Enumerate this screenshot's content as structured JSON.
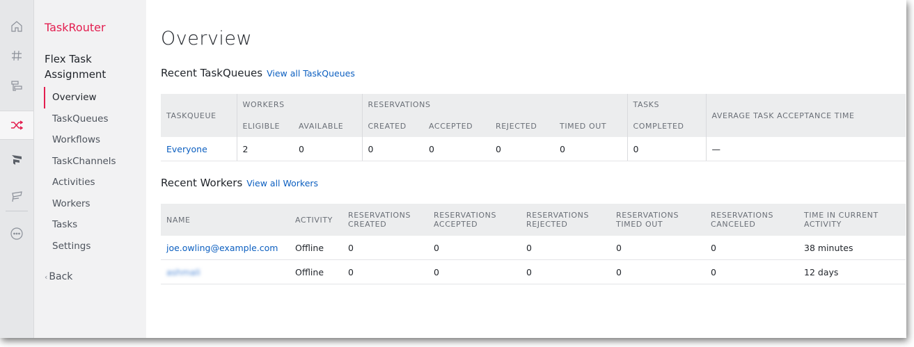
{
  "rail": {
    "icons": [
      "home-icon",
      "hash-icon",
      "studio-icon",
      "taskrouter-icon",
      "flex-icon",
      "functions-icon",
      "more-icon"
    ]
  },
  "nav": {
    "product": "TaskRouter",
    "workspace": "Flex Task Assignment",
    "items": [
      {
        "label": "Overview",
        "active": true
      },
      {
        "label": "TaskQueues"
      },
      {
        "label": "Workflows"
      },
      {
        "label": "TaskChannels"
      },
      {
        "label": "Activities"
      },
      {
        "label": "Workers"
      },
      {
        "label": "Tasks"
      },
      {
        "label": "Settings"
      }
    ],
    "back": "Back"
  },
  "main": {
    "title": "Overview",
    "queues": {
      "title": "Recent TaskQueues",
      "link": "View all TaskQueues",
      "group_headers": {
        "workers": "WORKERS",
        "reservations": "RESERVATIONS",
        "tasks": "TASKS"
      },
      "headers": {
        "taskqueue": "TASKQUEUE",
        "eligible": "ELIGIBLE",
        "available": "AVAILABLE",
        "created": "CREATED",
        "accepted": "ACCEPTED",
        "rejected": "REJECTED",
        "timed_out": "TIMED OUT",
        "completed": "COMPLETED",
        "avg_time": "AVERAGE TASK ACCEPTANCE TIME"
      },
      "rows": [
        {
          "name": "Everyone",
          "eligible": "2",
          "available": "0",
          "created": "0",
          "accepted": "0",
          "rejected": "0",
          "timed_out": "0",
          "completed": "0",
          "avg_time": "—"
        }
      ]
    },
    "workers": {
      "title": "Recent Workers",
      "link": "View all Workers",
      "headers": {
        "name": "NAME",
        "activity": "ACTIVITY",
        "res_created": "RESERVATIONS CREATED",
        "res_accepted": "RESERVATIONS ACCEPTED",
        "res_rejected": "RESERVATIONS REJECTED",
        "res_timed_out": "RESERVATIONS TIMED OUT",
        "res_canceled": "RESERVATIONS CANCELED",
        "time_in_activity": "TIME IN CURRENT ACTIVITY"
      },
      "rows": [
        {
          "name": "joe.owling@example.com",
          "activity": "Offline",
          "created": "0",
          "accepted": "0",
          "rejected": "0",
          "timed_out": "0",
          "canceled": "0",
          "time": "38 minutes"
        },
        {
          "name": "ashmali",
          "activity": "Offline",
          "created": "0",
          "accepted": "0",
          "rejected": "0",
          "timed_out": "0",
          "canceled": "0",
          "time": "12 days"
        }
      ]
    }
  }
}
